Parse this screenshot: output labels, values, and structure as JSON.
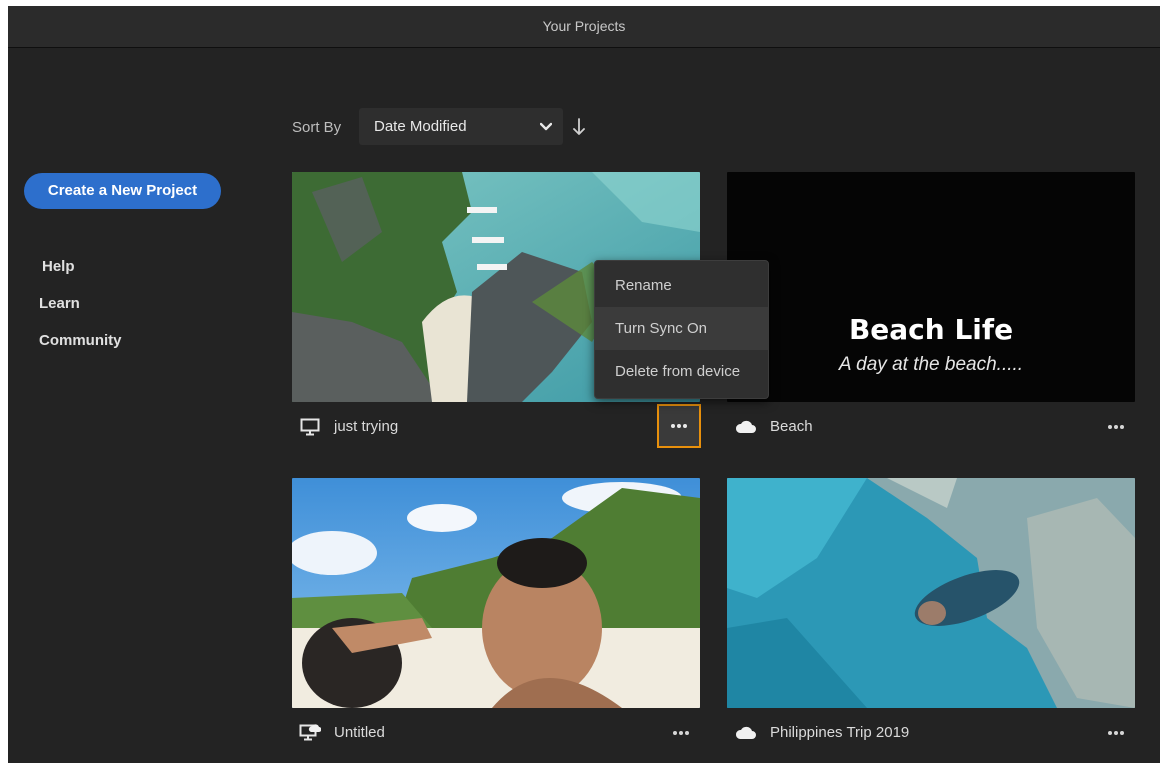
{
  "window": {
    "title": "Your Projects"
  },
  "sidebar": {
    "create_button": "Create a New Project",
    "links": [
      "Help",
      "Learn",
      "Community"
    ]
  },
  "sort": {
    "label": "Sort By",
    "selected": "Date Modified",
    "direction": "descending"
  },
  "projects": [
    {
      "name": "just trying",
      "storage_icon": "desktop-icon"
    },
    {
      "name": "Beach",
      "storage_icon": "cloud-icon",
      "thumb_title": "Beach Life",
      "thumb_subtitle": "A day at the beach....."
    },
    {
      "name": "Untitled",
      "storage_icon": "desktop-cloud-icon"
    },
    {
      "name": "Philippines Trip 2019",
      "storage_icon": "cloud-icon"
    }
  ],
  "context_menu": {
    "items": [
      "Rename",
      "Turn Sync On",
      "Delete from device"
    ],
    "highlighted": "Turn Sync On"
  },
  "colors": {
    "accent": "#2d6fcc",
    "focus_ring": "#e8900c",
    "background": "#232323"
  }
}
